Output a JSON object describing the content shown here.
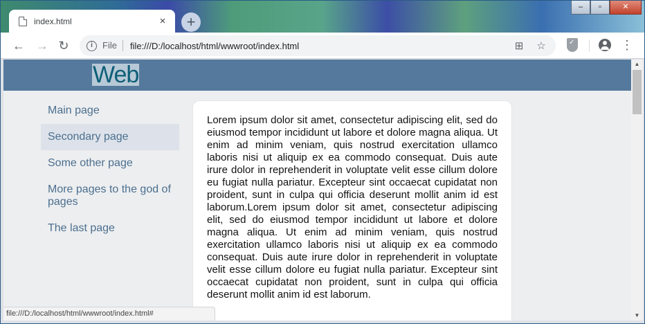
{
  "browser": {
    "tab": {
      "title": "index.html",
      "close": "×"
    },
    "new_tab": "+",
    "window_controls": {
      "minimize": "–",
      "maximize": "▫",
      "close": "✕"
    },
    "toolbar": {
      "back": "←",
      "forward": "→",
      "reload": "↻",
      "scheme_label": "File",
      "url": "file:///D:/localhost/html/wwwroot/index.html",
      "translate_icon": "⊞",
      "bookmark_icon": "☆",
      "menu_icon": "⋮"
    },
    "status_url": "file:///D:/localhost/html/wwwroot/index.html#"
  },
  "site": {
    "logo": "Web",
    "nav": [
      {
        "label": "Main page"
      },
      {
        "label": "Secondary page",
        "active": true
      },
      {
        "label": "Some other page"
      },
      {
        "label": "More pages to the god of pages"
      },
      {
        "label": "The last page"
      }
    ],
    "content": "Lorem ipsum dolor sit amet, consectetur adipiscing elit, sed do eiusmod tempor incididunt ut labore et dolore magna aliqua. Ut enim ad minim veniam, quis nostrud exercitation ullamco laboris nisi ut aliquip ex ea commodo consequat. Duis aute irure dolor in reprehenderit in voluptate velit esse cillum dolore eu fugiat nulla pariatur. Excepteur sint occaecat cupidatat non proident, sunt in culpa qui officia deserunt mollit anim id est laborum.Lorem ipsum dolor sit amet, consectetur adipiscing elit, sed do eiusmod tempor incididunt ut labore et dolore magna aliqua. Ut enim ad minim veniam, quis nostrud exercitation ullamco laboris nisi ut aliquip ex ea commodo consequat. Duis aute irure dolor in reprehenderit in voluptate velit esse cillum dolore eu fugiat nulla pariatur. Excepteur sint occaecat cupidatat non proident, sunt in culpa qui officia deserunt mollit anim id est laborum."
  },
  "colors": {
    "header_bg": "#55799c",
    "logo_text": "#0e5e78",
    "nav_text": "#4b6f8e",
    "nav_active_bg": "#dde2ea",
    "page_bg": "#edeef0"
  }
}
